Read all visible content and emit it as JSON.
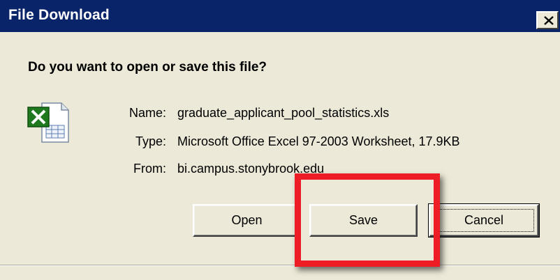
{
  "window": {
    "title": "File Download",
    "close_glyph": "X"
  },
  "dialog": {
    "question": "Do you want to open or save this file?",
    "icon": "excel-file-icon",
    "details": [
      {
        "label": "Name:",
        "value": "graduate_applicant_pool_statistics.xls"
      },
      {
        "label": "Type:",
        "value": "Microsoft Office Excel 97-2003 Worksheet, 17.9KB"
      },
      {
        "label": "From:",
        "value": "bi.campus.stonybrook.edu"
      }
    ],
    "buttons": {
      "open": "Open",
      "save": "Save",
      "cancel": "Cancel"
    }
  },
  "colors": {
    "titlebar": "#0a246a",
    "dialog_bg": "#ece9d8",
    "highlight": "#ee1c25",
    "excel_green": "#1f7a1f"
  }
}
